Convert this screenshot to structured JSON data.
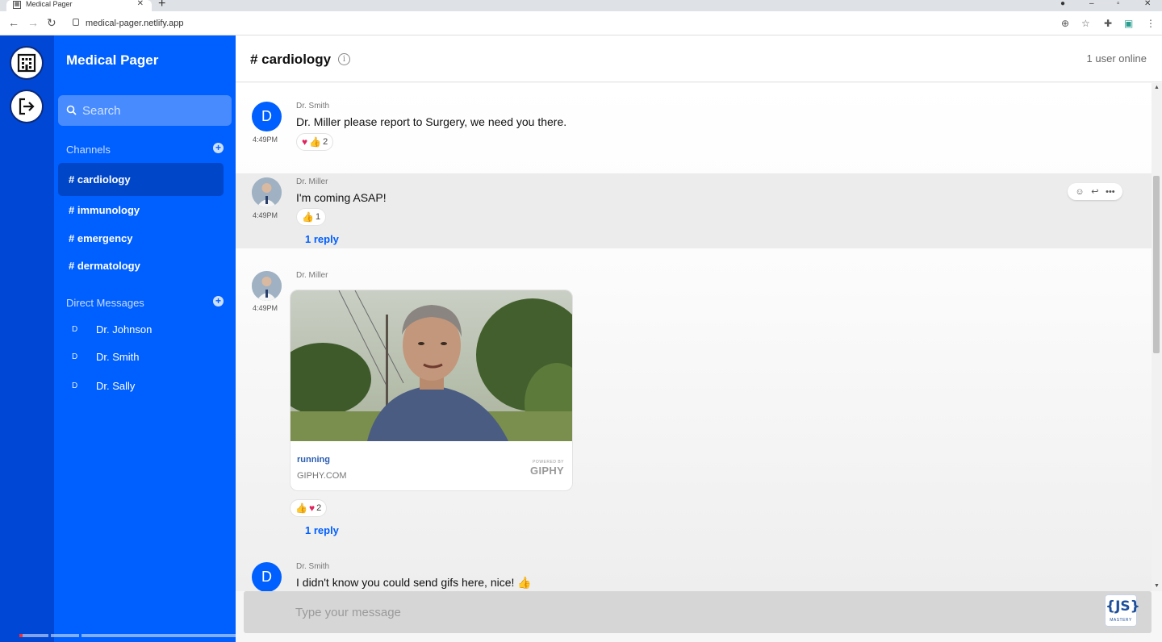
{
  "browser": {
    "tab_title": "Medical Pager",
    "url": "medical-pager.netlify.app"
  },
  "app": {
    "name": "Medical Pager"
  },
  "sidebar": {
    "search_placeholder": "Search",
    "channels_title": "Channels",
    "channels": [
      {
        "label": "# cardiology",
        "active": true
      },
      {
        "label": "# immunology",
        "active": false
      },
      {
        "label": "# emergency",
        "active": false
      },
      {
        "label": "# dermatology",
        "active": false
      }
    ],
    "dm_title": "Direct Messages",
    "dms": [
      {
        "initial": "D",
        "name": "Dr. Johnson"
      },
      {
        "initial": "D",
        "name": "Dr. Smith"
      },
      {
        "initial": "D",
        "name": "Dr. Sally"
      }
    ]
  },
  "channel": {
    "title": "# cardiology",
    "online": "1 user online"
  },
  "messages": [
    {
      "author": "Dr. Smith",
      "avatar_initial": "D",
      "time": "4:49PM",
      "text": "Dr. Miller please report to Surgery, we need you there.",
      "reaction_count": "2"
    },
    {
      "author": "Dr. Miller",
      "time": "4:49PM",
      "text": "I'm coming ASAP!",
      "reaction_count": "1",
      "reply": "1 reply"
    },
    {
      "author": "Dr. Miller",
      "time": "4:49PM",
      "gif": {
        "title": "running",
        "site": "GIPHY.COM",
        "powered_by": "POWERED BY",
        "brand": "GIPHY"
      },
      "reaction_count": "2",
      "reply": "1 reply"
    },
    {
      "author": "Dr. Smith",
      "avatar_initial": "D",
      "text": "I didn't know you could send gifs here, nice! 👍"
    }
  ],
  "composer": {
    "placeholder": "Type your message"
  },
  "watermark": {
    "brand": "{JS}",
    "sub": "MASTERY"
  },
  "colors": {
    "rail": "#0047d6",
    "sidebar": "#005fff",
    "active_channel": "#0046c8",
    "link": "#005fff"
  },
  "icons": [
    "hospital-icon",
    "logout-icon",
    "search-icon",
    "info-icon",
    "heart-icon",
    "thumbs-up-icon",
    "emoji-icon",
    "reply-icon",
    "more-icon"
  ]
}
